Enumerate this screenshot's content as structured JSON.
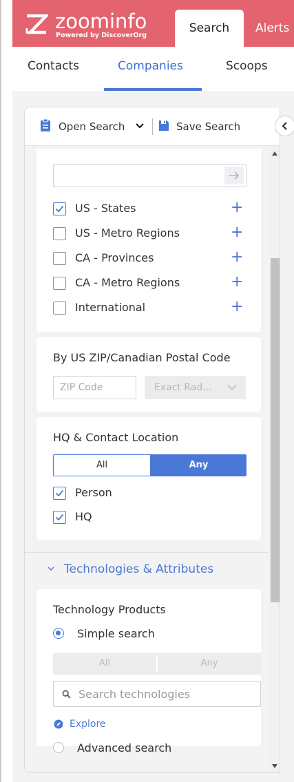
{
  "header": {
    "brand": "zoominfo",
    "brand_sub": "Powered by DiscoverOrg",
    "tabs": [
      {
        "label": "Search",
        "active": true
      },
      {
        "label": "Alerts",
        "active": false
      }
    ],
    "accent_color": "#e3636e"
  },
  "subtabs": [
    {
      "label": "Contacts",
      "active": false
    },
    {
      "label": "Companies",
      "active": true
    },
    {
      "label": "Scoops",
      "active": false
    }
  ],
  "toolbar": {
    "open_search_label": "Open Search",
    "save_search_label": "Save Search",
    "open_icon": "clipboard-icon",
    "save_icon": "floppy-disk-icon"
  },
  "location": {
    "input_value": "",
    "options": [
      {
        "label": "US - States",
        "checked": true
      },
      {
        "label": "US - Metro Regions",
        "checked": false
      },
      {
        "label": "CA - Provinces",
        "checked": false
      },
      {
        "label": "CA - Metro Regions",
        "checked": false
      },
      {
        "label": "International",
        "checked": false
      }
    ]
  },
  "zip": {
    "title": "By US ZIP/Canadian Postal Code",
    "placeholder": "ZIP Code",
    "radius_label": "Exact Rad..."
  },
  "hq": {
    "title": "HQ & Contact Location",
    "toggle_all": "All",
    "toggle_any": "Any",
    "selected": "Any",
    "options": [
      {
        "label": "Person",
        "checked": true
      },
      {
        "label": "HQ",
        "checked": true
      }
    ]
  },
  "tech": {
    "section_title": "Technologies & Attributes",
    "products_title": "Technology Products",
    "simple_label": "Simple search",
    "advanced_label": "Advanced search",
    "mode": "simple",
    "toggle_all": "All",
    "toggle_any": "Any",
    "search_placeholder": "Search technologies",
    "explore_label": "Explore"
  },
  "colors": {
    "primary": "#4a78d6",
    "brand": "#e3636e"
  }
}
